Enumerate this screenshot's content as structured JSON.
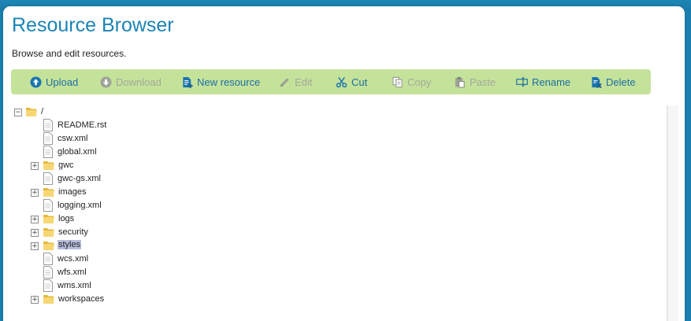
{
  "page": {
    "title": "Resource Browser",
    "subtitle": "Browse and edit resources."
  },
  "toolbar": {
    "upload": "Upload",
    "download": "Download",
    "new_resource": "New resource",
    "edit": "Edit",
    "cut": "Cut",
    "copy": "Copy",
    "paste": "Paste",
    "rename": "Rename",
    "delete": "Delete"
  },
  "tree": {
    "root": "/",
    "items": [
      {
        "name": "README.rst",
        "type": "file"
      },
      {
        "name": "csw.xml",
        "type": "file"
      },
      {
        "name": "global.xml",
        "type": "file"
      },
      {
        "name": "gwc",
        "type": "folder"
      },
      {
        "name": "gwc-gs.xml",
        "type": "file"
      },
      {
        "name": "images",
        "type": "folder"
      },
      {
        "name": "logging.xml",
        "type": "file"
      },
      {
        "name": "logs",
        "type": "folder"
      },
      {
        "name": "security",
        "type": "folder"
      },
      {
        "name": "styles",
        "type": "folder",
        "selected": true
      },
      {
        "name": "wcs.xml",
        "type": "file"
      },
      {
        "name": "wfs.xml",
        "type": "file"
      },
      {
        "name": "wms.xml",
        "type": "file"
      },
      {
        "name": "workspaces",
        "type": "folder"
      }
    ]
  },
  "colors": {
    "accent": "#1b84b5",
    "toolbar_bg": "#c5e29b",
    "link": "#1b6fa3",
    "disabled": "#a3a89a",
    "selection": "#b8bedd"
  }
}
